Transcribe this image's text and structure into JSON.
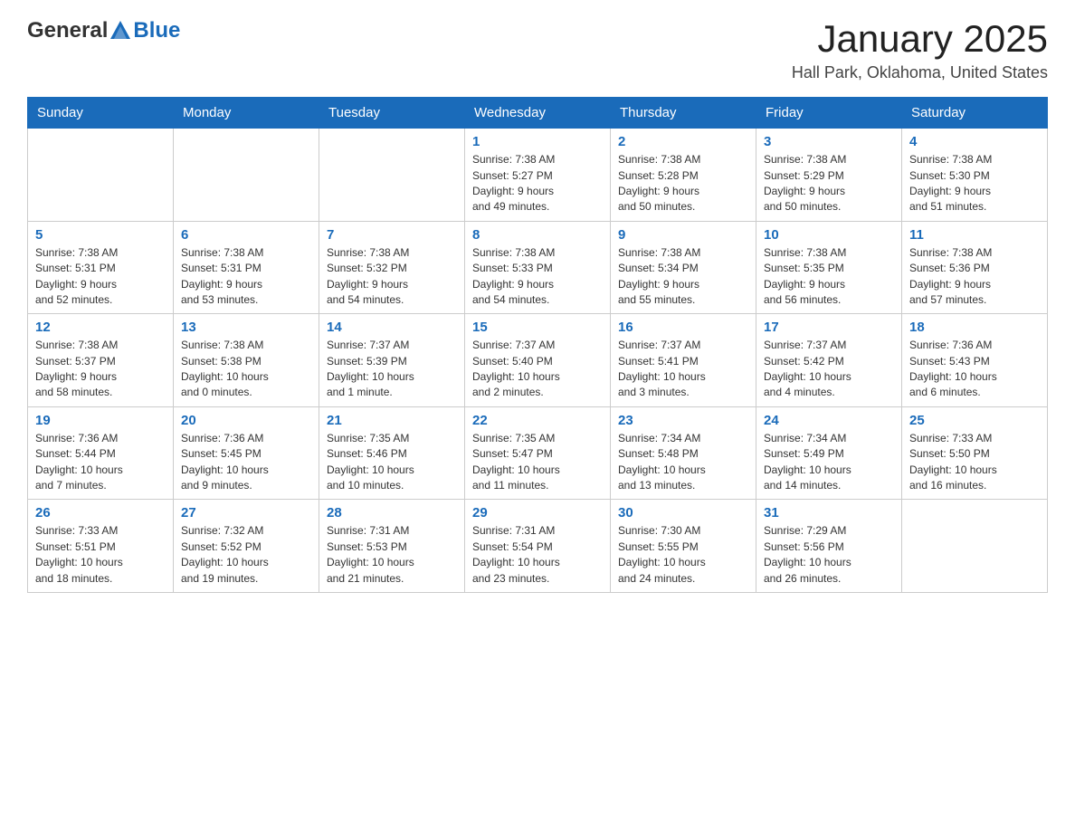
{
  "header": {
    "logo_general": "General",
    "logo_blue": "Blue",
    "month": "January 2025",
    "location": "Hall Park, Oklahoma, United States"
  },
  "weekdays": [
    "Sunday",
    "Monday",
    "Tuesday",
    "Wednesday",
    "Thursday",
    "Friday",
    "Saturday"
  ],
  "weeks": [
    [
      {
        "day": "",
        "info": ""
      },
      {
        "day": "",
        "info": ""
      },
      {
        "day": "",
        "info": ""
      },
      {
        "day": "1",
        "info": "Sunrise: 7:38 AM\nSunset: 5:27 PM\nDaylight: 9 hours\nand 49 minutes."
      },
      {
        "day": "2",
        "info": "Sunrise: 7:38 AM\nSunset: 5:28 PM\nDaylight: 9 hours\nand 50 minutes."
      },
      {
        "day": "3",
        "info": "Sunrise: 7:38 AM\nSunset: 5:29 PM\nDaylight: 9 hours\nand 50 minutes."
      },
      {
        "day": "4",
        "info": "Sunrise: 7:38 AM\nSunset: 5:30 PM\nDaylight: 9 hours\nand 51 minutes."
      }
    ],
    [
      {
        "day": "5",
        "info": "Sunrise: 7:38 AM\nSunset: 5:31 PM\nDaylight: 9 hours\nand 52 minutes."
      },
      {
        "day": "6",
        "info": "Sunrise: 7:38 AM\nSunset: 5:31 PM\nDaylight: 9 hours\nand 53 minutes."
      },
      {
        "day": "7",
        "info": "Sunrise: 7:38 AM\nSunset: 5:32 PM\nDaylight: 9 hours\nand 54 minutes."
      },
      {
        "day": "8",
        "info": "Sunrise: 7:38 AM\nSunset: 5:33 PM\nDaylight: 9 hours\nand 54 minutes."
      },
      {
        "day": "9",
        "info": "Sunrise: 7:38 AM\nSunset: 5:34 PM\nDaylight: 9 hours\nand 55 minutes."
      },
      {
        "day": "10",
        "info": "Sunrise: 7:38 AM\nSunset: 5:35 PM\nDaylight: 9 hours\nand 56 minutes."
      },
      {
        "day": "11",
        "info": "Sunrise: 7:38 AM\nSunset: 5:36 PM\nDaylight: 9 hours\nand 57 minutes."
      }
    ],
    [
      {
        "day": "12",
        "info": "Sunrise: 7:38 AM\nSunset: 5:37 PM\nDaylight: 9 hours\nand 58 minutes."
      },
      {
        "day": "13",
        "info": "Sunrise: 7:38 AM\nSunset: 5:38 PM\nDaylight: 10 hours\nand 0 minutes."
      },
      {
        "day": "14",
        "info": "Sunrise: 7:37 AM\nSunset: 5:39 PM\nDaylight: 10 hours\nand 1 minute."
      },
      {
        "day": "15",
        "info": "Sunrise: 7:37 AM\nSunset: 5:40 PM\nDaylight: 10 hours\nand 2 minutes."
      },
      {
        "day": "16",
        "info": "Sunrise: 7:37 AM\nSunset: 5:41 PM\nDaylight: 10 hours\nand 3 minutes."
      },
      {
        "day": "17",
        "info": "Sunrise: 7:37 AM\nSunset: 5:42 PM\nDaylight: 10 hours\nand 4 minutes."
      },
      {
        "day": "18",
        "info": "Sunrise: 7:36 AM\nSunset: 5:43 PM\nDaylight: 10 hours\nand 6 minutes."
      }
    ],
    [
      {
        "day": "19",
        "info": "Sunrise: 7:36 AM\nSunset: 5:44 PM\nDaylight: 10 hours\nand 7 minutes."
      },
      {
        "day": "20",
        "info": "Sunrise: 7:36 AM\nSunset: 5:45 PM\nDaylight: 10 hours\nand 9 minutes."
      },
      {
        "day": "21",
        "info": "Sunrise: 7:35 AM\nSunset: 5:46 PM\nDaylight: 10 hours\nand 10 minutes."
      },
      {
        "day": "22",
        "info": "Sunrise: 7:35 AM\nSunset: 5:47 PM\nDaylight: 10 hours\nand 11 minutes."
      },
      {
        "day": "23",
        "info": "Sunrise: 7:34 AM\nSunset: 5:48 PM\nDaylight: 10 hours\nand 13 minutes."
      },
      {
        "day": "24",
        "info": "Sunrise: 7:34 AM\nSunset: 5:49 PM\nDaylight: 10 hours\nand 14 minutes."
      },
      {
        "day": "25",
        "info": "Sunrise: 7:33 AM\nSunset: 5:50 PM\nDaylight: 10 hours\nand 16 minutes."
      }
    ],
    [
      {
        "day": "26",
        "info": "Sunrise: 7:33 AM\nSunset: 5:51 PM\nDaylight: 10 hours\nand 18 minutes."
      },
      {
        "day": "27",
        "info": "Sunrise: 7:32 AM\nSunset: 5:52 PM\nDaylight: 10 hours\nand 19 minutes."
      },
      {
        "day": "28",
        "info": "Sunrise: 7:31 AM\nSunset: 5:53 PM\nDaylight: 10 hours\nand 21 minutes."
      },
      {
        "day": "29",
        "info": "Sunrise: 7:31 AM\nSunset: 5:54 PM\nDaylight: 10 hours\nand 23 minutes."
      },
      {
        "day": "30",
        "info": "Sunrise: 7:30 AM\nSunset: 5:55 PM\nDaylight: 10 hours\nand 24 minutes."
      },
      {
        "day": "31",
        "info": "Sunrise: 7:29 AM\nSunset: 5:56 PM\nDaylight: 10 hours\nand 26 minutes."
      },
      {
        "day": "",
        "info": ""
      }
    ]
  ]
}
